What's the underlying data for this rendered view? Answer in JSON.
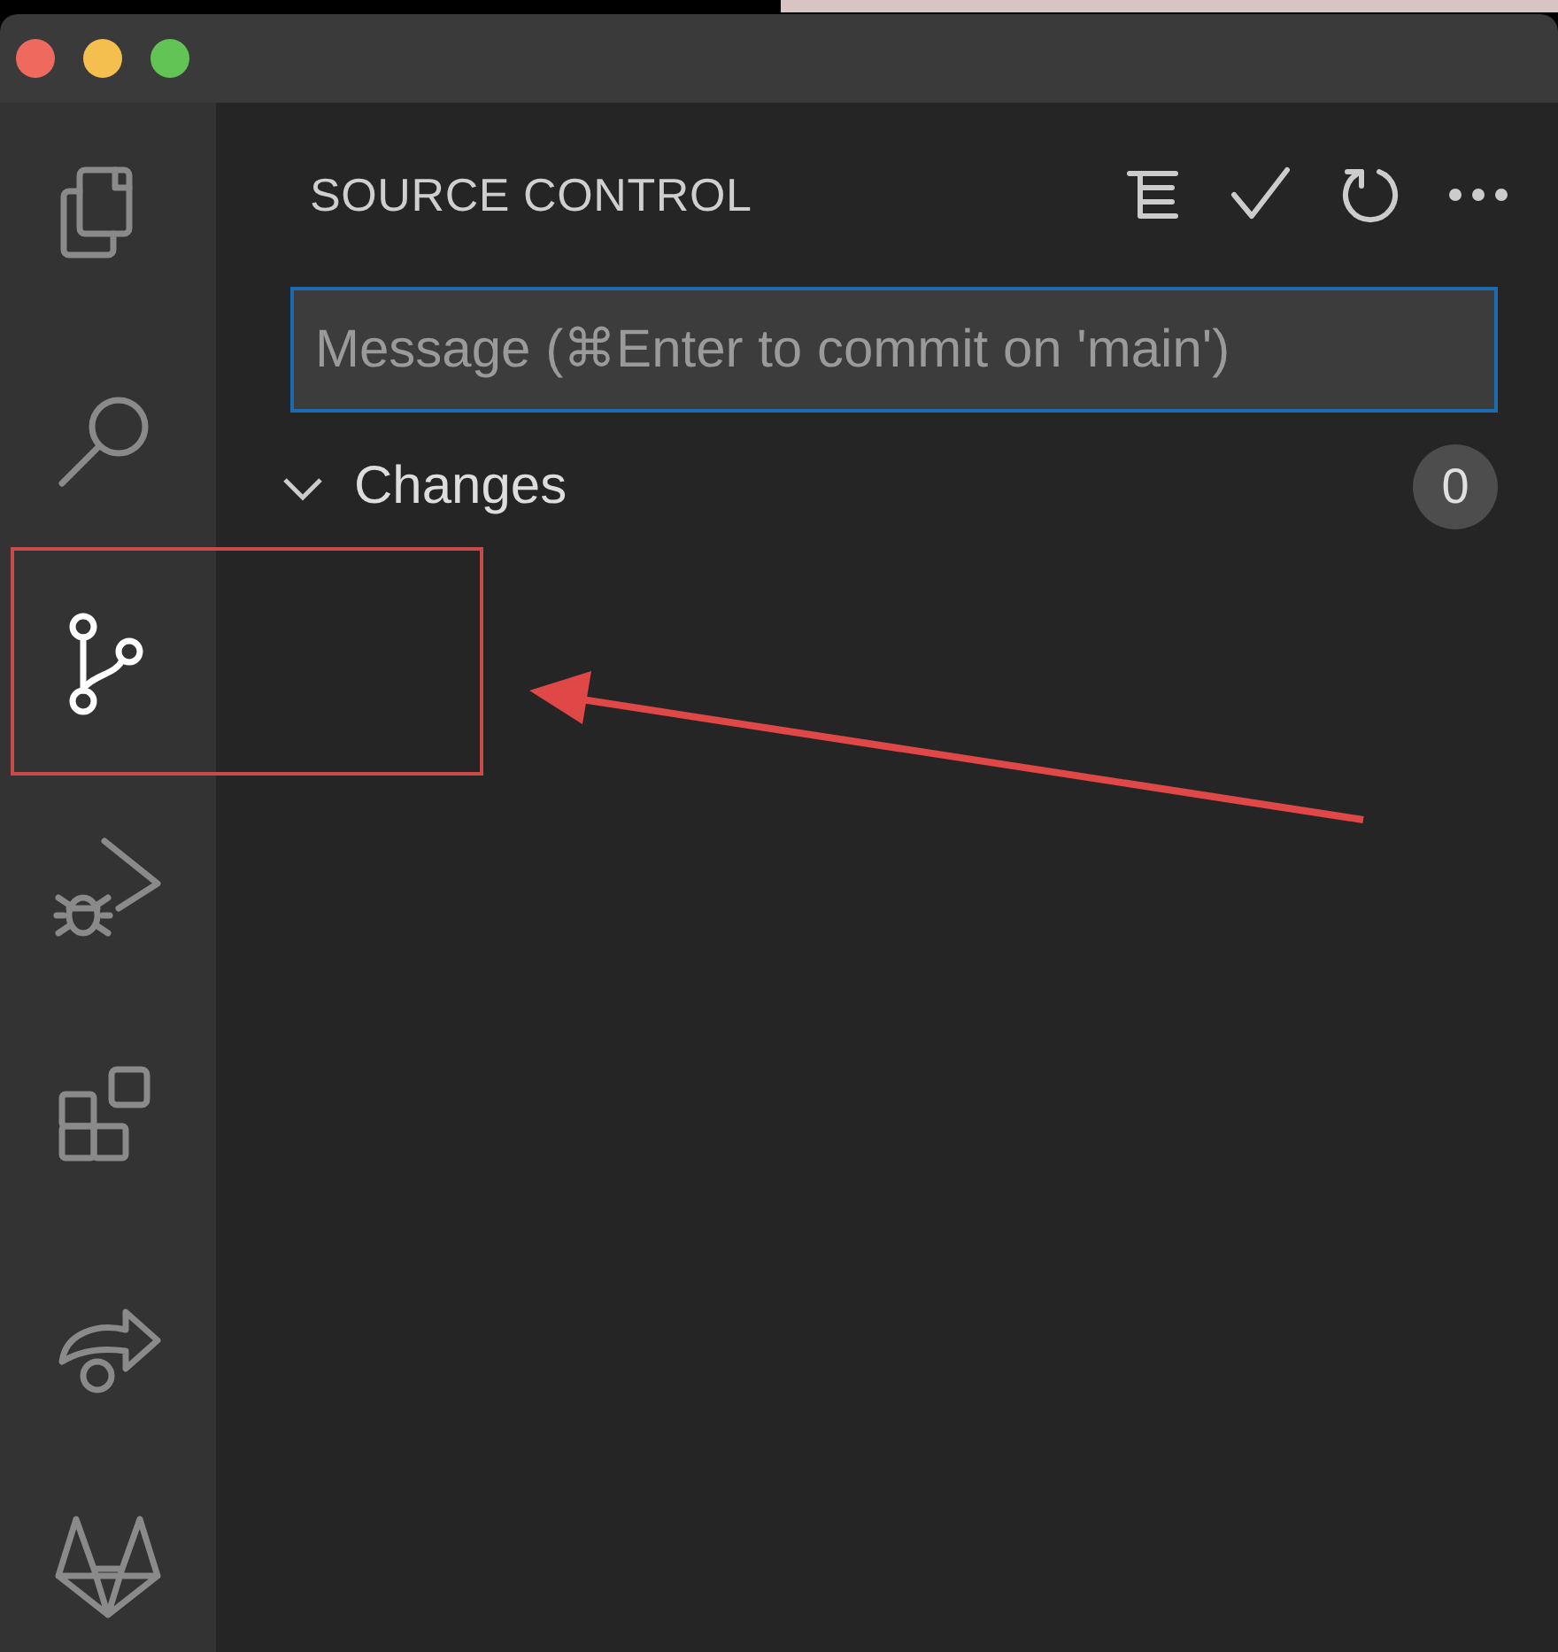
{
  "activity_bar": [
    {
      "kind": "files",
      "selected": false
    },
    {
      "kind": "search",
      "selected": false
    },
    {
      "kind": "source-control",
      "selected": true
    },
    {
      "kind": "run-debug",
      "selected": false
    },
    {
      "kind": "extensions",
      "selected": false
    },
    {
      "kind": "remote",
      "selected": false
    },
    {
      "kind": "fox",
      "selected": false
    }
  ],
  "sidebar": {
    "title": "SOURCE CONTROL",
    "commit_message": {
      "placeholder": "Message (⌘Enter to commit on 'main')"
    },
    "sections": [
      {
        "label": "Changes",
        "expanded": true,
        "count": "0"
      }
    ]
  }
}
